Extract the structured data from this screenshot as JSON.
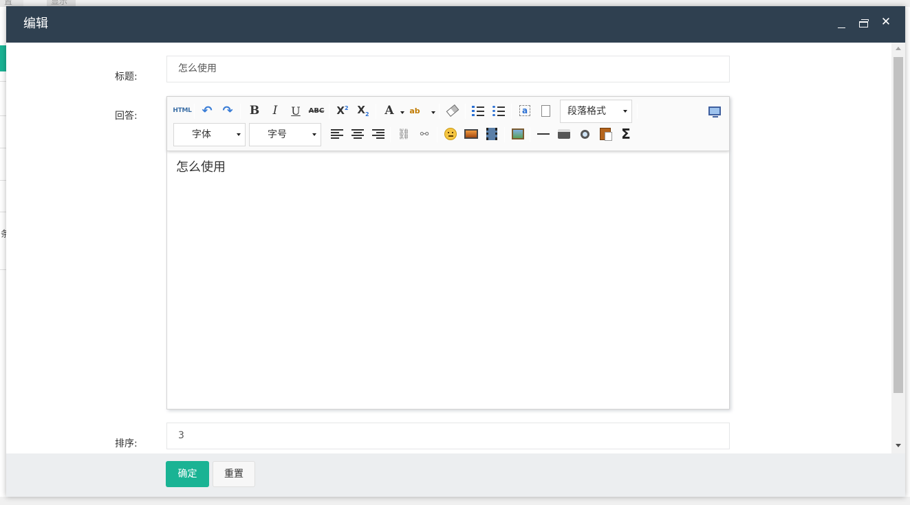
{
  "background": {
    "tab1_label": "置",
    "tab2_label": "显示",
    "side_char": "条"
  },
  "dialog": {
    "title": "编辑",
    "minimize_icon": "minimize-icon",
    "maximize_icon": "maximize-icon",
    "close_icon": "close-icon",
    "close_glyph": "✕"
  },
  "form": {
    "title_label": "标题:",
    "title_value": "怎么使用",
    "answer_label": "回答:",
    "order_label": "排序:",
    "order_value": "3"
  },
  "editor": {
    "toolbar": {
      "html_label": "HTML",
      "bold_label": "B",
      "italic_label": "I",
      "underline_label": "U",
      "strike_label": "ABC",
      "font_color_label": "A",
      "bg_color_label": "ab",
      "paragraph_format": "段落格式",
      "font_family": "字体",
      "font_size": "字号",
      "anchor_label": "a",
      "sigma_label": "Σ"
    },
    "content": "怎么使用"
  },
  "footer": {
    "confirm_label": "确定",
    "reset_label": "重置"
  },
  "colors": {
    "header_bg": "#2f4050",
    "primary": "#1ab394",
    "footer_bg": "#eceef0"
  }
}
